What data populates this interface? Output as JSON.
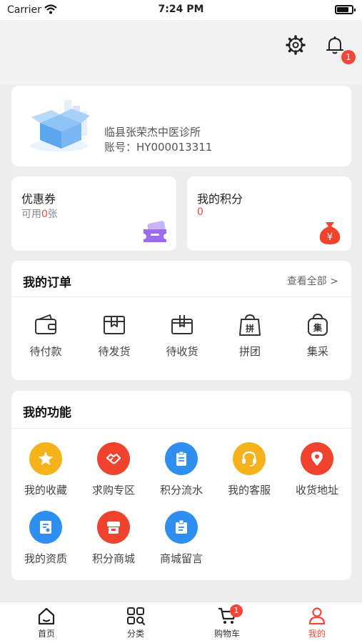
{
  "status_bar": {
    "carrier": "Carrier",
    "time": "7:24 PM"
  },
  "header": {
    "notification_count": "1"
  },
  "profile": {
    "name": "临县张荣杰中医诊所",
    "account": "账号：HY000013311"
  },
  "coupon": {
    "title": "优惠券",
    "prefix": "可用",
    "count": "0",
    "suffix": "张"
  },
  "points": {
    "title": "我的积分",
    "value": "0"
  },
  "orders": {
    "title": "我的订单",
    "view_all": "查看全部 >",
    "items": [
      {
        "label": "待付款",
        "icon": "wallet-icon"
      },
      {
        "label": "待发货",
        "icon": "package-icon"
      },
      {
        "label": "待收货",
        "icon": "receive-box-icon"
      },
      {
        "label": "拼团",
        "icon": "group-buy-bag-icon"
      },
      {
        "label": "集采",
        "icon": "bulk-purchase-bag-icon"
      }
    ]
  },
  "features": {
    "title": "我的功能",
    "items": [
      {
        "label": "我的收藏",
        "icon": "star-icon",
        "color": "#f5b21b"
      },
      {
        "label": "求购专区",
        "icon": "handshake-icon",
        "color": "#f0432d"
      },
      {
        "label": "积分流水",
        "icon": "clipboard-icon",
        "color": "#2f8ff0"
      },
      {
        "label": "我的客服",
        "icon": "headset-icon",
        "color": "#f5b21b"
      },
      {
        "label": "收货地址",
        "icon": "location-pin-icon",
        "color": "#f0432d"
      },
      {
        "label": "我的资质",
        "icon": "certificate-icon",
        "color": "#2f8ff0"
      },
      {
        "label": "积分商城",
        "icon": "store-icon",
        "color": "#f0432d"
      },
      {
        "label": "商城留言",
        "icon": "message-board-icon",
        "color": "#2f8ff0"
      }
    ]
  },
  "tabbar": {
    "items": [
      {
        "label": "首页",
        "icon": "home-icon"
      },
      {
        "label": "分类",
        "icon": "category-grid-icon"
      },
      {
        "label": "购物车",
        "icon": "cart-icon"
      },
      {
        "label": "我的",
        "icon": "user-icon"
      }
    ],
    "cart_count": "1",
    "active_color": "#f3453a"
  }
}
